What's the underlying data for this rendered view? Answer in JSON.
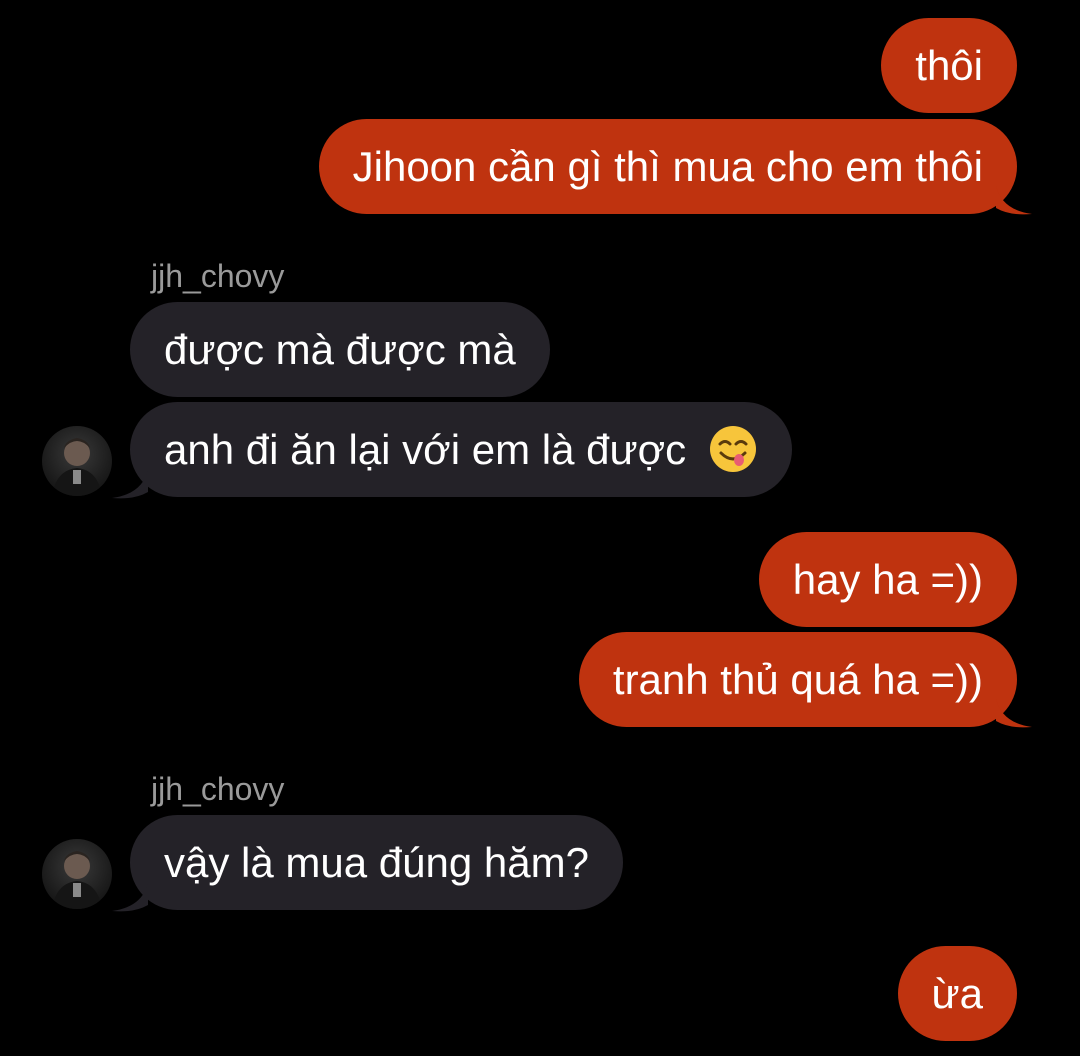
{
  "messages": [
    {
      "direction": "outgoing",
      "text": "thôi"
    },
    {
      "direction": "outgoing",
      "text": "Jihoon cần gì thì mua cho em thôi"
    },
    {
      "direction": "incoming",
      "sender": "jjh_chovy",
      "text": "được mà được mà"
    },
    {
      "direction": "incoming",
      "text": "anh đi ăn lại với em là được",
      "emoji": "yum-face-emoji"
    },
    {
      "direction": "outgoing",
      "text": "hay ha =))"
    },
    {
      "direction": "outgoing",
      "text": "tranh thủ quá ha =))"
    },
    {
      "direction": "incoming",
      "sender": "jjh_chovy",
      "text": "vậy là mua đúng hăm?"
    },
    {
      "direction": "outgoing",
      "text": "ừa"
    }
  ],
  "colors": {
    "background": "#000000",
    "outgoing_bubble": "#bf330f",
    "incoming_bubble": "#242228",
    "sender_name": "#9a9a9a",
    "text": "#ffffff"
  }
}
